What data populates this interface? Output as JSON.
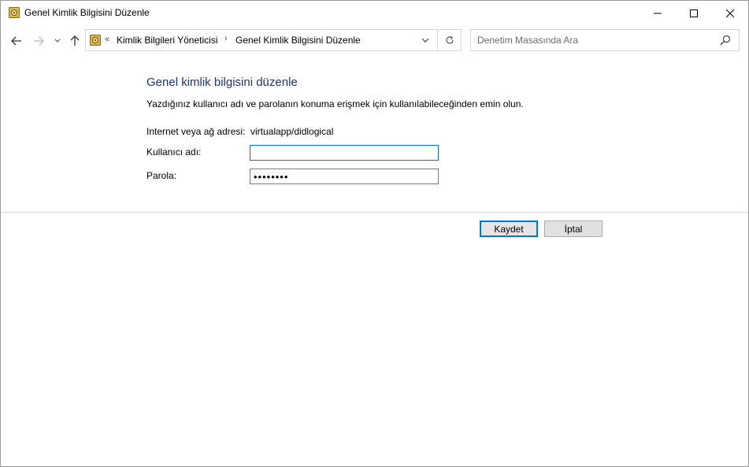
{
  "window": {
    "title": "Genel Kimlik Bilgisini Düzenle",
    "icon": "credential-vault-icon"
  },
  "navigation": {
    "breadcrumb_prefix": "«",
    "breadcrumbs": [
      {
        "label": "Kimlik Bilgileri Yöneticisi"
      },
      {
        "label": "Genel Kimlik Bilgisini Düzenle"
      }
    ],
    "separator": "›",
    "search_placeholder": "Denetim Masasında Ara"
  },
  "form": {
    "heading": "Genel kimlik bilgisini düzenle",
    "description": "Yazdığınız kullanıcı adı ve parolanın konuma erişmek için kullanılabileceğinden emin olun.",
    "address_label": "Internet veya ağ adresi:",
    "address_value": "virtualapp/didlogical",
    "username_label": "Kullanıcı adı:",
    "username_value": "",
    "password_label": "Parola:",
    "password_value": "••••••••"
  },
  "buttons": {
    "save_label": "Kaydet",
    "cancel_label": "İptal"
  },
  "colors": {
    "heading": "#1e3287",
    "focus_accent": "#0078d7"
  }
}
